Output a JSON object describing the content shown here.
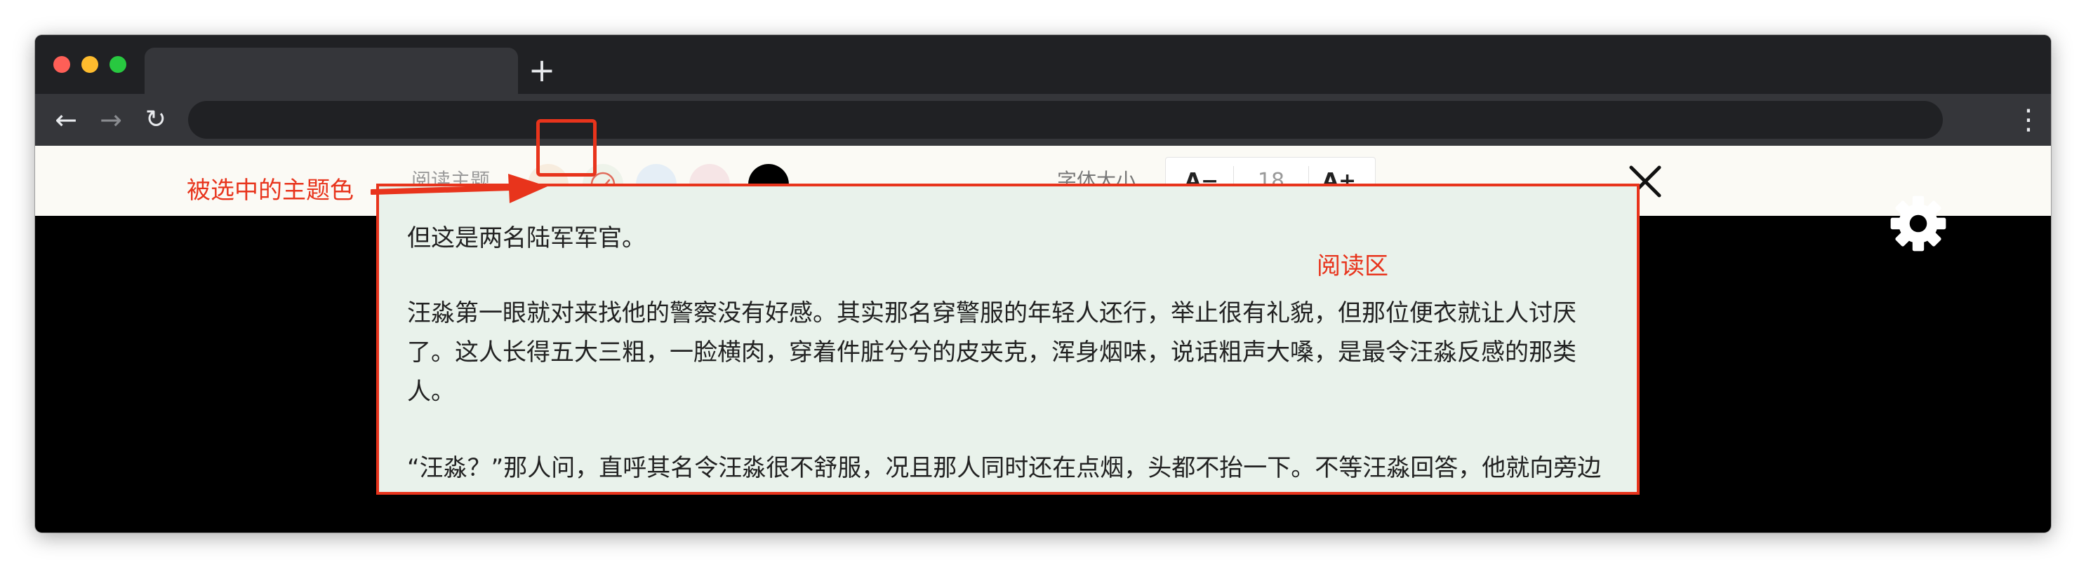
{
  "browser": {
    "new_tab_label": "+",
    "back_icon": "arrow-left-icon",
    "forward_icon": "arrow-right-icon",
    "reload_icon": "reload-icon",
    "menu_icon": "more-vertical-icon"
  },
  "settings": {
    "theme_label": "阅读主题",
    "themes": [
      {
        "name": "beige",
        "color": "#f7ecde",
        "selected": false
      },
      {
        "name": "green",
        "color": "#eef3ea",
        "selected": true
      },
      {
        "name": "blue",
        "color": "#e5eef6",
        "selected": false
      },
      {
        "name": "pink",
        "color": "#f6e5e6",
        "selected": false
      },
      {
        "name": "black",
        "color": "#000000",
        "selected": false
      }
    ],
    "font_size_label": "字体大小",
    "decrease_label": "A−",
    "font_size_value": "18",
    "increase_label": "A+",
    "close_icon": "close-icon"
  },
  "reading": {
    "paragraphs": [
      "但这是两名陆军军官。",
      "汪淼第一眼就对来找他的警察没有好感。其实那名穿警服的年轻人还行，举止很有礼貌，但那位便衣就让人讨厌了。这人长得五大三粗，一脸横肉，穿着件脏兮兮的皮夹克，浑身烟味，说话粗声大嗓，是最令汪淼反感的那类人。",
      "“汪淼？”那人问，直呼其名令汪淼很不舒服，况且那人同时还在点烟，头都不抬一下。不等汪淼回答，他就向旁边那位年轻人示意了一下，后者向汪淼出示了警官证，他点完烟后就直接向屋里闯。"
    ]
  },
  "settings_icon": "gear-icon",
  "annotations": {
    "selected_theme": "被选中的主题色",
    "reading_area": "阅读区"
  },
  "colors": {
    "accent_red": "#e8341c",
    "reading_bg": "#e9f2eb",
    "settings_bg": "#fbfaf5"
  }
}
